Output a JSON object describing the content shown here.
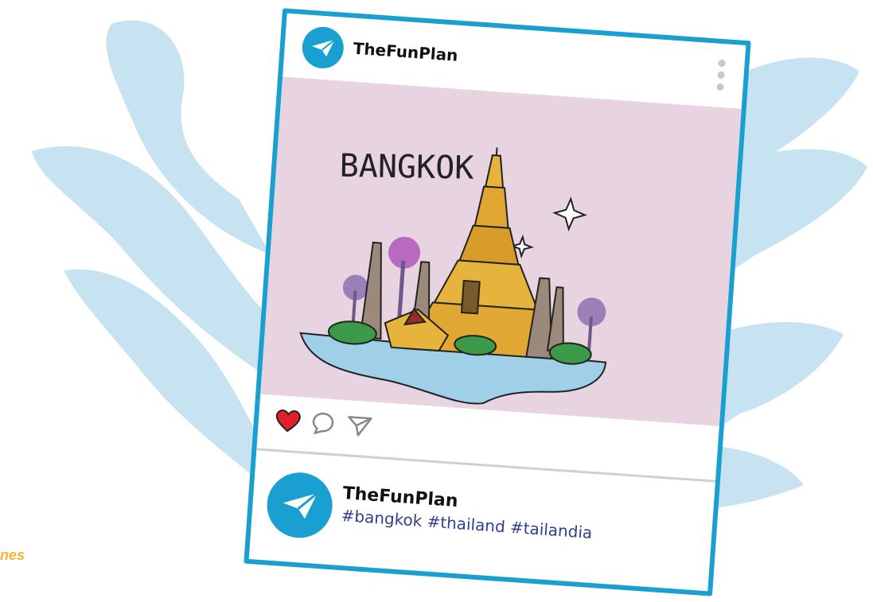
{
  "post": {
    "account_name": "TheFunPlan",
    "photo_title": "BANGKOK",
    "caption_name": "TheFunPlan",
    "caption_tags": "#bangkok #thailand #tailandia",
    "liked": true
  },
  "left_snippet": "nes",
  "icons": {
    "avatar": "paper-plane-icon",
    "menu": "more-dots-icon",
    "like": "heart-icon",
    "comment": "comment-icon",
    "share": "send-icon"
  },
  "colors": {
    "brand": "#1aa0d0",
    "splash": "#c7e2f0",
    "photo_bg": "#e8d3e1",
    "water": "#9fd0e8",
    "heart": "#e0202a",
    "hashtags": "#2f3f8e",
    "snippet": "#f2b53a"
  }
}
